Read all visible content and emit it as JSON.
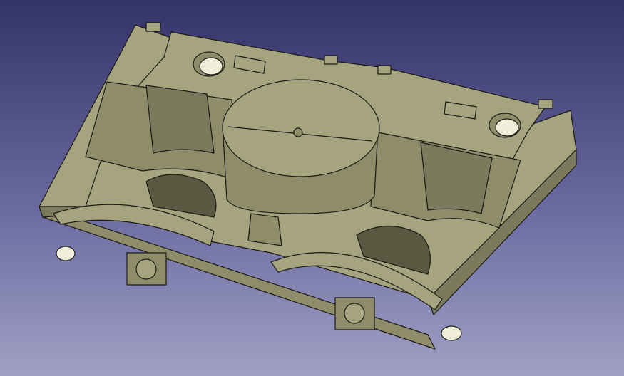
{
  "viewport": {
    "background_top": "#33336a",
    "background_bottom": "#a0a0c4"
  },
  "model": {
    "face_light": "#a6a37f",
    "face_mid": "#8f8c6a",
    "face_dark": "#6f6c50",
    "edge_color": "#1a1a14",
    "hole_color": "#f0eed8"
  }
}
